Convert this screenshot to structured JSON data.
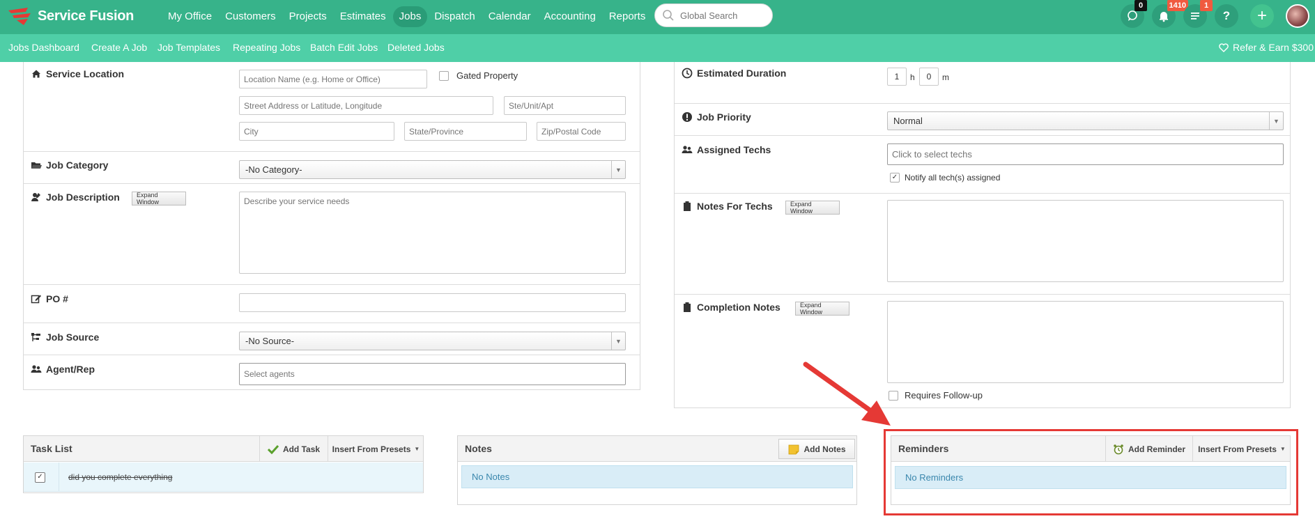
{
  "app": {
    "logo_text": "Service Fusion",
    "brand_color": "#37b38a",
    "accent_color": "#e53935"
  },
  "main_nav": [
    "My Office",
    "Customers",
    "Projects",
    "Estimates",
    "Jobs",
    "Dispatch",
    "Calendar",
    "Accounting",
    "Reports"
  ],
  "active_nav": "Jobs",
  "search": {
    "placeholder": "Global Search"
  },
  "top_icons": {
    "chat_count": "0",
    "notifications_count": "1410",
    "tasks_count": "1",
    "help_label": "?",
    "add_label": "+"
  },
  "sub_nav": [
    "Jobs Dashboard",
    "Create A Job",
    "Job Templates",
    "Repeating Jobs",
    "Batch Edit Jobs",
    "Deleted Jobs"
  ],
  "refer": "Refer & Earn $300",
  "left_form": {
    "service_location": {
      "label": "Service Location",
      "location_name_placeholder": "Location Name (e.g. Home or Office)",
      "gated_property": "Gated Property",
      "street_placeholder": "Street Address or Latitude, Longitude",
      "unit_placeholder": "Ste/Unit/Apt",
      "city_placeholder": "City",
      "state_placeholder": "State/Province",
      "zip_placeholder": "Zip/Postal Code"
    },
    "job_category": {
      "label": "Job Category",
      "value": "-No Category-"
    },
    "job_description": {
      "label": "Job Description",
      "expand": "Expand Window",
      "placeholder": "Describe your service needs"
    },
    "po": {
      "label": "PO #",
      "value": ""
    },
    "job_source": {
      "label": "Job Source",
      "value": "-No Source-"
    },
    "agent_rep": {
      "label": "Agent/Rep",
      "placeholder": "Select agents"
    }
  },
  "right_form": {
    "estimated_duration": {
      "label": "Estimated Duration",
      "hours": "1",
      "hours_unit": "h",
      "minutes": "0",
      "minutes_unit": "m"
    },
    "job_priority": {
      "label": "Job Priority",
      "value": "Normal"
    },
    "assigned_techs": {
      "label": "Assigned Techs",
      "placeholder": "Click to select techs",
      "notify": "Notify all tech(s) assigned",
      "notify_checked": true
    },
    "notes_for_techs": {
      "label": "Notes For Techs",
      "expand": "Expand Window"
    },
    "completion_notes": {
      "label": "Completion Notes",
      "expand": "Expand Window"
    },
    "requires_followup": "Requires Follow-up"
  },
  "task_list": {
    "title": "Task List",
    "add_button": "Add Task",
    "presets_button": "Insert From Presets",
    "tasks": [
      {
        "text": "did you complete everything",
        "done": true
      }
    ]
  },
  "notes": {
    "title": "Notes",
    "add_button": "Add Notes",
    "empty": "No Notes"
  },
  "reminders": {
    "title": "Reminders",
    "add_button": "Add Reminder",
    "presets_button": "Insert From Presets",
    "empty": "No Reminders"
  }
}
